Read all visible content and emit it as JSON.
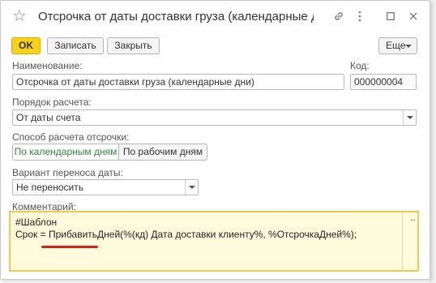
{
  "window": {
    "title": "Отсрочка от даты доставки груза (календарные дни)"
  },
  "toolbar": {
    "ok_label": "OK",
    "save_label": "Записать",
    "close_label": "Закрыть",
    "more_label": "Еще"
  },
  "form": {
    "name_label": "Наименование:",
    "name_value": "Отсрочка от даты доставки груза (календарные дни)",
    "code_label": "Код:",
    "code_value": "000000004",
    "calc_order_label": "Порядок расчета:",
    "calc_order_value": "От даты счета",
    "delay_method_label": "Способ расчета отсрочки:",
    "delay_method_options": [
      "По календарным дням",
      "По рабочим дням"
    ],
    "delay_method_selected": "По календарным дням",
    "date_transfer_label": "Вариант переноса даты:",
    "date_transfer_value": "Не переносить",
    "comment_label": "Комментарий:",
    "comment_line1": "#Шаблон",
    "comment_line2": "Срок = ПрибавитьДней(%(кд) Дата доставки клиенту%, %ОтсрочкаДней%);",
    "comment_more": "..."
  },
  "colors": {
    "ok_button": "#f8d21a",
    "comment_border": "#f3c74e",
    "comment_bg": "#fffbdc",
    "active_segment_text": "#2f8a3a",
    "underline": "#d8211a"
  }
}
